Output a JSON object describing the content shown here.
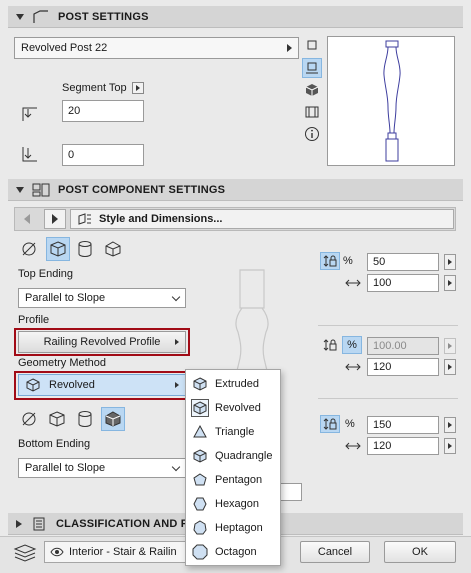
{
  "post_settings": {
    "title": "POST SETTINGS",
    "name_dropdown": "Revolved Post 22",
    "segment_top_label": "Segment Top",
    "top_value": "20",
    "bottom_value": "0"
  },
  "component_settings": {
    "title": "POST COMPONENT SETTINGS",
    "page_label": "Style and Dimensions...",
    "top_ending_label": "Top Ending",
    "top_ending_value": "Parallel to Slope",
    "profile_label": "Profile",
    "profile_value": "Railing Revolved Profile",
    "geometry_label": "Geometry Method",
    "geometry_value": "Revolved",
    "bottom_ending_label": "Bottom Ending",
    "bottom_ending_value": "Parallel to Slope",
    "percent_symbol": "%",
    "top_row": {
      "percent": "50",
      "width": "100"
    },
    "mid_row": {
      "percent": "100.00",
      "width": "120"
    },
    "bottom_row": {
      "percent": "150",
      "width": "120"
    }
  },
  "geometry_menu": {
    "items": [
      "Extruded",
      "Revolved",
      "Triangle",
      "Quadrangle",
      "Pentagon",
      "Hexagon",
      "Heptagon",
      "Octagon"
    ],
    "checked": "Revolved"
  },
  "classification": {
    "title": "CLASSIFICATION AND PR"
  },
  "footer": {
    "layer_value": "Interior - Stair & Railin",
    "cancel_label": "Cancel",
    "ok_label": "OK"
  },
  "colors": {
    "highlight_border": "#a10b16",
    "selection_fill": "#cde2f6",
    "toggle_selected": "#b9d7f2"
  }
}
